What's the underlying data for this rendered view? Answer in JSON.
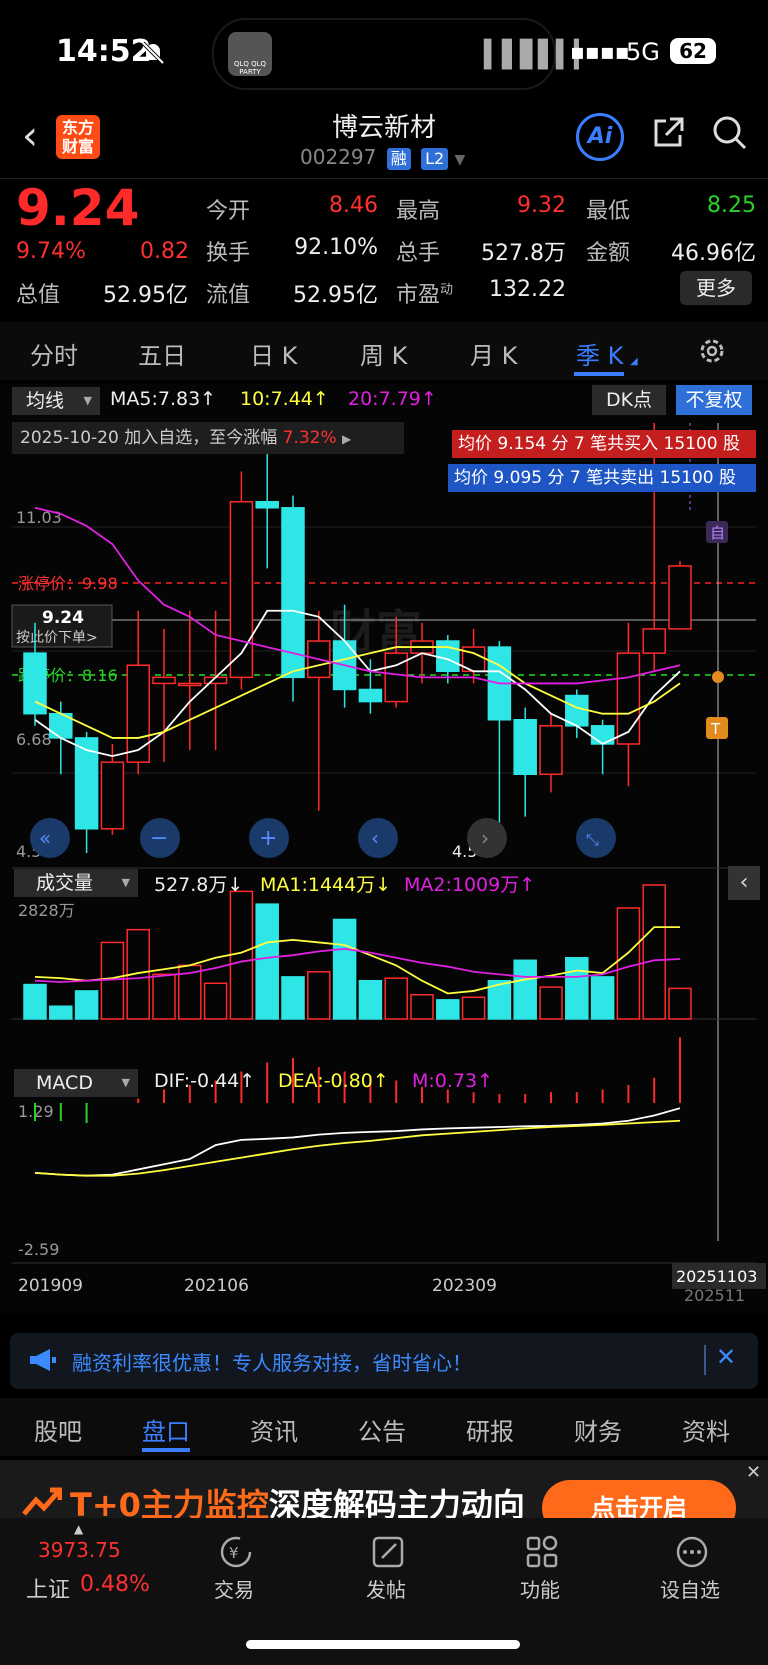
{
  "status_bar": {
    "time": "14:52",
    "network": "5G",
    "battery": "62",
    "island_art": "QLQ QLQ PARTY"
  },
  "header": {
    "stock_name": "博云新材",
    "stock_code": "002297",
    "badge_margin": "融",
    "badge_level": "L2",
    "logo_line1": "东方",
    "logo_line2": "财富",
    "ai_label": "Ai"
  },
  "quote": {
    "price": "9.24",
    "change_pct": "9.74%",
    "change": "0.82",
    "fields": [
      {
        "label": "今开",
        "value": "8.46",
        "color": "#ff3030"
      },
      {
        "label": "最高",
        "value": "9.32",
        "color": "#ff3030"
      },
      {
        "label": "最低",
        "value": "8.25",
        "color": "#28d228"
      },
      {
        "label": "换手",
        "value": "92.10%",
        "color": "#eeeeee"
      },
      {
        "label": "总手",
        "value": "527.8万",
        "color": "#eeeeee"
      },
      {
        "label": "金额",
        "value": "46.96亿",
        "color": "#eeeeee"
      },
      {
        "label": "总值",
        "value": "52.95亿",
        "color": "#eeeeee"
      },
      {
        "label": "流值",
        "value": "52.95亿",
        "color": "#eeeeee"
      },
      {
        "label": "市盈",
        "label_sup": "动",
        "value": "132.22",
        "color": "#eeeeee"
      }
    ],
    "more_label": "更多"
  },
  "period_tabs": [
    "分时",
    "五日",
    "日 K",
    "周 K",
    "月 K",
    "季 K"
  ],
  "active_period": "季 K",
  "kline": {
    "ma_selector": "均线",
    "ma5": "MA5:7.83↑",
    "ma10": "10:7.44↑",
    "ma20": "20:7.79↑",
    "dk_label": "DK点",
    "adjust_label": "不复权",
    "watch_note_prefix": "2025-10-20 加入自选，至今涨幅",
    "watch_note_pct": "7.32%",
    "buy_note": "均价 9.154 分 7 笔共买入 15100 股",
    "sell_note": "均价 9.095 分 7 笔共卖出 15100 股",
    "y_top": "11.03",
    "y_low": "6.68",
    "y_bottom": "4.50",
    "limit_up_label": "涨停价：9.98",
    "limit_down_label": "跌停价：8.16",
    "current_price_tag": "9.24",
    "order_hint": "按此价下单>",
    "min_label": "4.50→",
    "mark_self": "自",
    "mark_t": "T"
  },
  "volume": {
    "selector": "成交量",
    "vol": "527.8万↓",
    "ma1": "MA1:1444万↓",
    "ma2": "MA2:1009万↑",
    "y_top": "2828万"
  },
  "macd": {
    "selector": "MACD",
    "dif": "DIF:-0.44↑",
    "dea": "DEA:-0.80↑",
    "m": "M:0.73↑",
    "y_top": "1.29",
    "y_bottom": "-2.59",
    "x_labels": [
      "201909",
      "202106",
      "202309"
    ],
    "cursor_date": "20251103",
    "last_date_partial": "202511"
  },
  "chart_data": {
    "type": "candlestick",
    "period": "quarter",
    "candles": [
      {
        "o": 7.8,
        "c": 6.8,
        "h": 8.3,
        "l": 6.6
      },
      {
        "o": 6.8,
        "c": 6.4,
        "h": 7.0,
        "l": 5.8
      },
      {
        "o": 6.4,
        "c": 4.9,
        "h": 6.5,
        "l": 4.5
      },
      {
        "o": 4.9,
        "c": 6.0,
        "h": 6.3,
        "l": 4.8
      },
      {
        "o": 6.0,
        "c": 7.6,
        "h": 8.5,
        "l": 5.8
      },
      {
        "o": 7.3,
        "c": 7.4,
        "h": 8.2,
        "l": 6.0
      },
      {
        "o": 7.3,
        "c": 7.3,
        "h": 8.5,
        "l": 6.2
      },
      {
        "o": 7.3,
        "c": 7.4,
        "h": 8.5,
        "l": 6.2
      },
      {
        "o": 7.4,
        "c": 10.3,
        "h": 10.8,
        "l": 7.2
      },
      {
        "o": 10.3,
        "c": 10.2,
        "h": 11.5,
        "l": 9.2
      },
      {
        "o": 10.2,
        "c": 7.4,
        "h": 10.4,
        "l": 7.0
      },
      {
        "o": 7.4,
        "c": 8.0,
        "h": 8.5,
        "l": 5.2
      },
      {
        "o": 8.0,
        "c": 7.2,
        "h": 8.6,
        "l": 6.9
      },
      {
        "o": 7.2,
        "c": 7.0,
        "h": 7.7,
        "l": 6.8
      },
      {
        "o": 7.0,
        "c": 7.8,
        "h": 8.4,
        "l": 6.9
      },
      {
        "o": 7.8,
        "c": 8.0,
        "h": 8.3,
        "l": 7.3
      },
      {
        "o": 8.0,
        "c": 7.5,
        "h": 8.1,
        "l": 7.3
      },
      {
        "o": 7.5,
        "c": 7.9,
        "h": 8.2,
        "l": 7.3
      },
      {
        "o": 7.9,
        "c": 6.7,
        "h": 8.0,
        "l": 4.5
      },
      {
        "o": 6.7,
        "c": 5.8,
        "h": 6.9,
        "l": 5.1
      },
      {
        "o": 5.8,
        "c": 6.6,
        "h": 6.8,
        "l": 5.5
      },
      {
        "o": 7.1,
        "c": 6.6,
        "h": 7.2,
        "l": 6.4
      },
      {
        "o": 6.6,
        "c": 6.3,
        "h": 6.7,
        "l": 5.8
      },
      {
        "o": 6.3,
        "c": 7.8,
        "h": 8.3,
        "l": 5.6
      },
      {
        "o": 7.8,
        "c": 8.2,
        "h": 11.6,
        "l": 7.5
      },
      {
        "o": 8.2,
        "c": 9.24,
        "h": 9.32,
        "l": 8.25
      }
    ],
    "ma_series": [
      {
        "name": "MA5",
        "color": "#ffffff",
        "values": [
          6.7,
          6.4,
          6.2,
          6.1,
          6.2,
          6.5,
          7.0,
          7.4,
          7.8,
          8.5,
          8.5,
          8.4,
          8.0,
          7.5,
          7.6,
          7.8,
          7.7,
          7.5,
          7.5,
          7.2,
          6.8,
          6.6,
          6.3,
          6.5,
          7.1,
          7.5
        ]
      },
      {
        "name": "MA10",
        "color": "#ffff40",
        "values": [
          7.0,
          6.8,
          6.6,
          6.4,
          6.4,
          6.5,
          6.7,
          6.9,
          7.1,
          7.3,
          7.5,
          7.6,
          7.7,
          7.8,
          7.9,
          7.9,
          7.9,
          7.8,
          7.6,
          7.3,
          7.1,
          6.9,
          6.8,
          6.8,
          7.0,
          7.3
        ]
      },
      {
        "name": "MA20",
        "color": "#e020e0",
        "values": [
          10.2,
          10.1,
          9.9,
          9.6,
          9.0,
          8.6,
          8.4,
          8.1,
          8.0,
          7.9,
          7.8,
          7.7,
          7.6,
          7.5,
          7.45,
          7.4,
          7.4,
          7.4,
          7.3,
          7.3,
          7.3,
          7.3,
          7.35,
          7.4,
          7.5,
          7.6
        ]
      }
    ],
    "volumes": [
      0.27,
      0.1,
      0.22,
      0.6,
      0.7,
      0.35,
      0.42,
      0.28,
      1.0,
      0.9,
      0.33,
      0.37,
      0.78,
      0.3,
      0.32,
      0.19,
      0.15,
      0.17,
      0.3,
      0.46,
      0.25,
      0.48,
      0.33,
      0.87,
      1.05,
      0.24
    ],
    "vol_ma1": [
      0.33,
      0.32,
      0.3,
      0.32,
      0.36,
      0.39,
      0.42,
      0.48,
      0.52,
      0.6,
      0.62,
      0.6,
      0.58,
      0.5,
      0.42,
      0.3,
      0.2,
      0.22,
      0.27,
      0.31,
      0.34,
      0.38,
      0.36,
      0.52,
      0.72,
      0.72
    ],
    "vol_ma2": [
      0.3,
      0.29,
      0.3,
      0.31,
      0.32,
      0.34,
      0.36,
      0.4,
      0.45,
      0.48,
      0.5,
      0.53,
      0.55,
      0.52,
      0.48,
      0.44,
      0.41,
      0.37,
      0.35,
      0.33,
      0.33,
      0.33,
      0.35,
      0.41,
      0.46,
      0.47
    ],
    "macd_hist": [
      -0.18,
      -0.18,
      -0.2,
      0,
      0.05,
      0.15,
      0.2,
      0.25,
      0.35,
      0.45,
      0.5,
      0.4,
      0.35,
      0.3,
      0.25,
      0.18,
      0.15,
      0.12,
      0.1,
      0.1,
      0.12,
      0.12,
      0.15,
      0.2,
      0.28,
      0.73
    ],
    "macd_dif": [
      -2.3,
      -2.35,
      -2.38,
      -2.35,
      -2.2,
      -2.05,
      -1.9,
      -1.5,
      -1.35,
      -1.32,
      -1.28,
      -1.2,
      -1.15,
      -1.12,
      -1.1,
      -1.05,
      -1.02,
      -1.0,
      -0.98,
      -0.96,
      -0.95,
      -0.92,
      -0.88,
      -0.8,
      -0.65,
      -0.44
    ],
    "macd_dea": [
      -2.3,
      -2.35,
      -2.38,
      -2.38,
      -2.32,
      -2.22,
      -2.1,
      -1.98,
      -1.86,
      -1.74,
      -1.62,
      -1.52,
      -1.44,
      -1.38,
      -1.3,
      -1.22,
      -1.17,
      -1.12,
      -1.07,
      -1.02,
      -0.98,
      -0.95,
      -0.92,
      -0.88,
      -0.84,
      -0.8
    ],
    "limit_up": 9.98,
    "limit_down": 8.16,
    "current": 9.24,
    "price_range": [
      4.5,
      11.6
    ],
    "macd_range": [
      -2.59,
      1.29
    ]
  },
  "banner": {
    "text": "融资利率很优惠！专人服务对接，省时省心！"
  },
  "bottom_tabs": [
    "股吧",
    "盘口",
    "资讯",
    "公告",
    "研报",
    "财务",
    "资料"
  ],
  "active_bottom_tab": "盘口",
  "promo": {
    "text_orange": "T+0主力监控",
    "text_white": "深度解码主力动向",
    "button": "点击开启"
  },
  "tab_bar": {
    "index_value": "3973.75",
    "index_name": "上证",
    "index_pct": "0.48%",
    "items": [
      "交易",
      "发帖",
      "功能",
      "设自选"
    ]
  }
}
